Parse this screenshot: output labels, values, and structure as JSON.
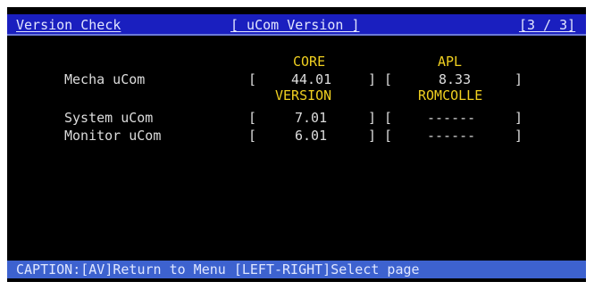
{
  "header": {
    "left": "Version Check",
    "center": "[ uCom Version ]",
    "page": "[3 / 3]"
  },
  "columns": {
    "core": "CORE",
    "apl": "APL",
    "version": "VERSION",
    "romcolle": "ROMCOLLE"
  },
  "rows": [
    {
      "label": "Mecha uCom",
      "left_value": "44.01",
      "right_value": "8.33"
    },
    {
      "label": "System uCom",
      "left_value": "7.01",
      "right_value": "------"
    },
    {
      "label": "Monitor uCom",
      "left_value": "6.01",
      "right_value": "------"
    }
  ],
  "brackets": {
    "open": "[",
    "close_open": "] [",
    "close": "]"
  },
  "footer": {
    "caption": "CAPTION:[AV]Return to Menu [LEFT-RIGHT]Select page"
  },
  "colors": {
    "screen_bg": "#000000",
    "header_bar": "#1a1fbf",
    "footer_bar": "#3d62cf",
    "label_text": "#dcdcdc",
    "column_header_text": "#f0d020"
  }
}
